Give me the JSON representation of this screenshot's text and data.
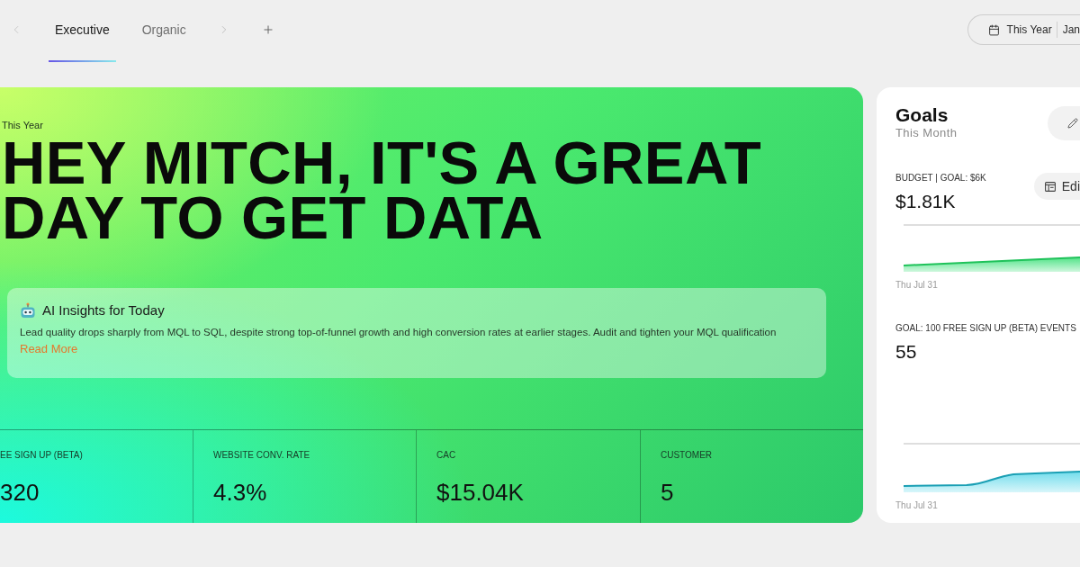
{
  "tabs": [
    {
      "label": "Executive",
      "selected": true
    },
    {
      "label": "Organic",
      "selected": false
    }
  ],
  "date_range": {
    "preset": "This Year",
    "range": "Jan"
  },
  "hero": {
    "period": "This Year",
    "headline": "HEY MITCH, IT'S A GREAT DAY TO GET DATA",
    "insights": {
      "title": "AI Insights for Today",
      "body": "Lead quality drops sharply from MQL to SQL, despite strong top-of-funnel growth and high conversion rates at earlier stages. Audit and tighten your MQL qualification",
      "link": "Read More"
    },
    "metrics": [
      {
        "label": "EE SIGN UP (BETA)",
        "value": "320"
      },
      {
        "label": "WEBSITE CONV. RATE",
        "value": "4.3%"
      },
      {
        "label": "CAC",
        "value": "$15.04K"
      },
      {
        "label": "CUSTOMER",
        "value": "5"
      }
    ]
  },
  "goals": {
    "title": "Goals",
    "subtitle": "This Month",
    "items": [
      {
        "kind": "budget",
        "label": "BUDGET | GOAL: $6K",
        "value": "$1.81K",
        "action": "Edi",
        "date": "Thu Jul 31"
      },
      {
        "kind": "events",
        "label": "GOAL: 100 FREE SIGN UP (BETA) EVENTS",
        "value": "55",
        "date": "Thu Jul 31"
      }
    ]
  }
}
